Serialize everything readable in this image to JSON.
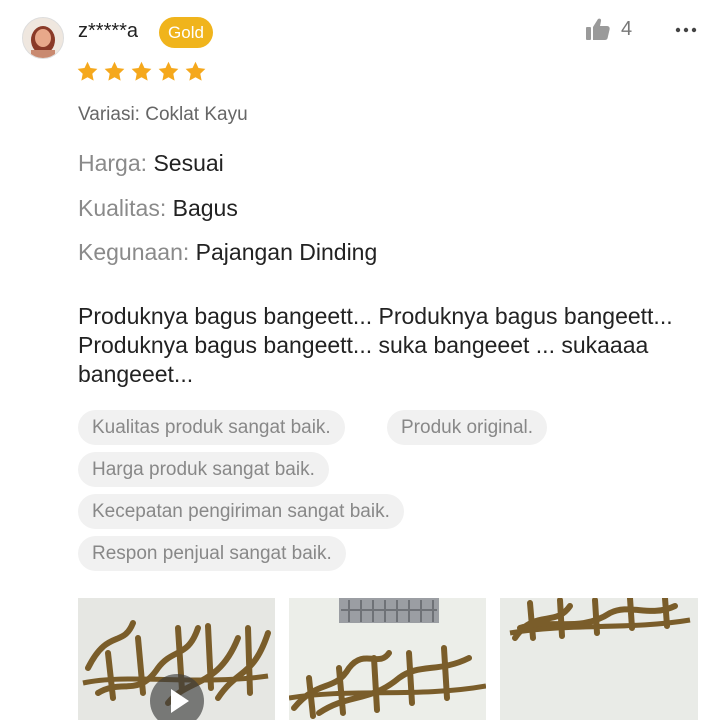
{
  "review": {
    "username": "z*****a",
    "badge": "Gold",
    "rating": 5,
    "like_count": "4",
    "variation": "Variasi: Coklat Kayu",
    "attributes": [
      {
        "key": "Harga:",
        "value": "Sesuai"
      },
      {
        "key": "Kualitas:",
        "value": "Bagus"
      },
      {
        "key": "Kegunaan:",
        "value": "Pajangan Dinding"
      }
    ],
    "text": "Produknya bagus bangeett... Produknya bagus bangeett... Produknya bagus bangeett... suka bangeeet ... sukaaaa bangeeet...",
    "tags": [
      "Kualitas produk sangat baik.",
      "Produk original.",
      "Harga produk sangat baik.",
      "Kecepatan pengiriman sangat baik.",
      "Respon penjual sangat baik."
    ]
  },
  "colors": {
    "badge": "#f0b41c",
    "star": "#f5a81c",
    "muted": "#888888",
    "tag_bg": "#f1f1f1"
  },
  "icons": {
    "like": "thumbs-up-icon",
    "more": "more-dots-icon",
    "play": "play-icon"
  }
}
